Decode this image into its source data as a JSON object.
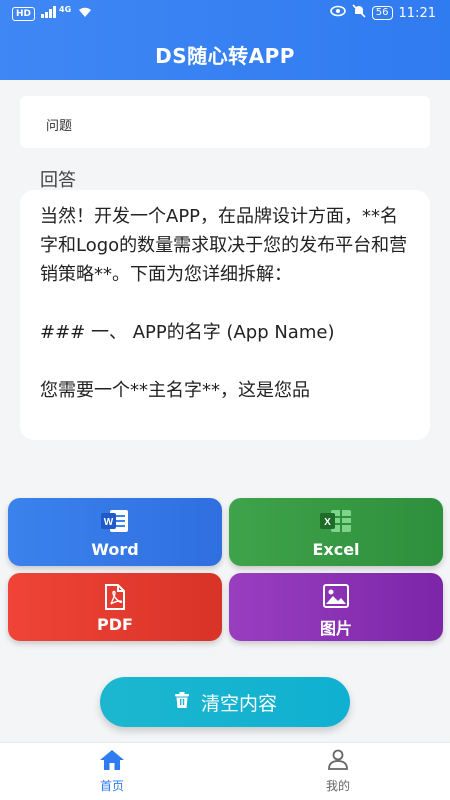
{
  "status_bar": {
    "left_badge": "HD",
    "signal": "4G",
    "battery": "56",
    "time": "11:21"
  },
  "header": {
    "title": "DS随心转APP"
  },
  "question": {
    "placeholder": "问题"
  },
  "answer": {
    "label": "回答",
    "text": "当然！开发一个APP，在品牌设计方面，**名字和Logo的数量需求取决于您的发布平台和营销策略**。下面为您详细拆解：\n\n### 一、 APP的名字 (App Name)\n\n您需要一个**主名字**，这是您品"
  },
  "buttons": {
    "word": "Word",
    "excel": "Excel",
    "pdf": "PDF",
    "image": "图片"
  },
  "clear_button": {
    "label": "清空内容"
  },
  "bottom_nav": {
    "home": "首页",
    "mine": "我的"
  },
  "colors": {
    "header": "#3f87f5",
    "word": "#3b82ec",
    "excel": "#3fa34a",
    "pdf": "#ef4437",
    "image": "#9a3ec0",
    "clear": "#1cb7cf",
    "nav_active": "#2f7bf0"
  }
}
